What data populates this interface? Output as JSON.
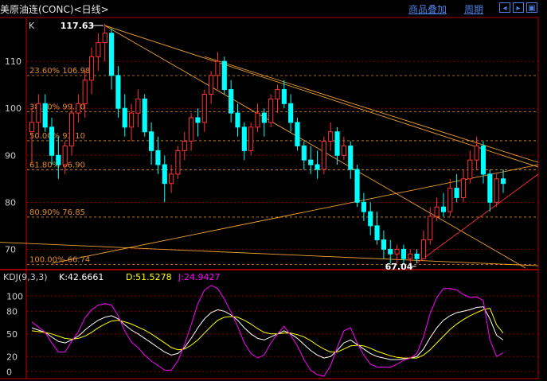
{
  "header": {
    "title": "美原油连(CONC)<日线>",
    "overlay_label": "商品叠加",
    "period_label": "周期",
    "icons": [
      "left-arrow-icon",
      "right-arrow-icon",
      "fullscreen-icon"
    ]
  },
  "price_panel": {
    "label": "K",
    "high_label": "117.63",
    "low_label": "67.04"
  },
  "kdj": {
    "name": "KDJ(9,3,3)",
    "k_label": "K:42.6661",
    "d_label": "D:51.5278",
    "j_label": "J:24.9427"
  },
  "colors": {
    "up": "#ff3232",
    "down": "#00ffff",
    "fib": "#e08a28",
    "trend": "#f0a030",
    "red_trend": "#ff3030",
    "k_line": "#ffffff",
    "d_line": "#ffff00",
    "j_line": "#ff00ff",
    "grid": "#8b0000",
    "axis": "#cc0000"
  },
  "chart_data": [
    {
      "type": "candlestick",
      "title": "美原油连(CONC)<日线>",
      "ylim": [
        66,
        119
      ],
      "y_ticks": [
        70,
        80,
        90,
        100,
        110
      ],
      "fib_levels": [
        {
          "label": "23.60% 106.98",
          "value": 106.98
        },
        {
          "label": "38.20% 99.30",
          "value": 99.3
        },
        {
          "label": "50.00% 93.10",
          "value": 93.1
        },
        {
          "label": "61.80% 86.90",
          "value": 86.9
        },
        {
          "label": "80.90% 76.85",
          "value": 76.85
        },
        {
          "label": "100.00% 66.74",
          "value": 66.74
        }
      ],
      "annotations": [
        {
          "text": "117.63",
          "value": 117.63
        },
        {
          "text": "67.04",
          "value": 67.04
        }
      ],
      "candles": [
        [
          95,
          100,
          88,
          97
        ],
        [
          97,
          103,
          94,
          101
        ],
        [
          101,
          103,
          95,
          96
        ],
        [
          96,
          98,
          88,
          90
        ],
        [
          90,
          94,
          85,
          88
        ],
        [
          88,
          93,
          86,
          92
        ],
        [
          92,
          101,
          90,
          99
        ],
        [
          99,
          103,
          97,
          101
        ],
        [
          101,
          108,
          98,
          106
        ],
        [
          106,
          113,
          103,
          111
        ],
        [
          111,
          116,
          108,
          114
        ],
        [
          114,
          118,
          110,
          116
        ],
        [
          116,
          117,
          104,
          107
        ],
        [
          107,
          109,
          98,
          100
        ],
        [
          100,
          103,
          94,
          96
        ],
        [
          96,
          101,
          93,
          99
        ],
        [
          99,
          104,
          96,
          102
        ],
        [
          102,
          103,
          94,
          95
        ],
        [
          95,
          97,
          88,
          91
        ],
        [
          91,
          94,
          86,
          88
        ],
        [
          88,
          90,
          80,
          84
        ],
        [
          84,
          88,
          82,
          86
        ],
        [
          86,
          92,
          85,
          91
        ],
        [
          91,
          95,
          89,
          93
        ],
        [
          93,
          99,
          91,
          98
        ],
        [
          98,
          100,
          94,
          97
        ],
        [
          97,
          104,
          95,
          103
        ],
        [
          103,
          108,
          101,
          107
        ],
        [
          107,
          112,
          104,
          110
        ],
        [
          110,
          111,
          103,
          104
        ],
        [
          104,
          106,
          97,
          99
        ],
        [
          99,
          101,
          94,
          96
        ],
        [
          96,
          97,
          89,
          91
        ],
        [
          91,
          97,
          90,
          96
        ],
        [
          96,
          101,
          95,
          99
        ],
        [
          99,
          100,
          94,
          97
        ],
        [
          97,
          103,
          96,
          102
        ],
        [
          102,
          105,
          99,
          104
        ],
        [
          104,
          106,
          100,
          101
        ],
        [
          101,
          103,
          95,
          97
        ],
        [
          97,
          98,
          91,
          92
        ],
        [
          92,
          93,
          87,
          89
        ],
        [
          89,
          92,
          86,
          88
        ],
        [
          88,
          91,
          85,
          87
        ],
        [
          87,
          94,
          86,
          93
        ],
        [
          93,
          97,
          91,
          95
        ],
        [
          95,
          96,
          88,
          90
        ],
        [
          90,
          94,
          89,
          92
        ],
        [
          92,
          93,
          85,
          87
        ],
        [
          87,
          88,
          79,
          80
        ],
        [
          80,
          82,
          76,
          78
        ],
        [
          78,
          80,
          73,
          75
        ],
        [
          75,
          78,
          71,
          72
        ],
        [
          72,
          74,
          68,
          70
        ],
        [
          70,
          72,
          67,
          69
        ],
        [
          69,
          71,
          67,
          70
        ],
        [
          70,
          71,
          67,
          68
        ],
        [
          68,
          70,
          67,
          69
        ],
        [
          69,
          70,
          67,
          68
        ],
        [
          68,
          74,
          68,
          72
        ],
        [
          72,
          79,
          71,
          77
        ],
        [
          77,
          81,
          76,
          79
        ],
        [
          79,
          82,
          77,
          78
        ],
        [
          78,
          85,
          77,
          83
        ],
        [
          83,
          86,
          80,
          81
        ],
        [
          81,
          87,
          80,
          85
        ],
        [
          85,
          91,
          84,
          89
        ],
        [
          89,
          94,
          87,
          92
        ],
        [
          92,
          93,
          84,
          86
        ],
        [
          86,
          87,
          78,
          80
        ],
        [
          80,
          86,
          79,
          85
        ],
        [
          85,
          87,
          82,
          84
        ]
      ]
    },
    {
      "type": "line",
      "title": "KDJ(9,3,3)",
      "ylim": [
        -5,
        115
      ],
      "y_ticks": [
        0,
        20,
        50,
        80,
        100
      ],
      "series": [
        {
          "name": "K",
          "values": [
            58,
            55,
            52,
            46,
            40,
            38,
            42,
            47,
            55,
            62,
            68,
            72,
            74,
            70,
            62,
            55,
            50,
            44,
            38,
            32,
            26,
            22,
            24,
            32,
            44,
            58,
            70,
            78,
            82,
            80,
            75,
            68,
            58,
            50,
            44,
            42,
            46,
            50,
            54,
            50,
            44,
            36,
            28,
            22,
            18,
            20,
            28,
            38,
            42,
            36,
            30,
            24,
            20,
            18,
            16,
            16,
            17,
            18,
            20,
            30,
            45,
            58,
            68,
            74,
            78,
            80,
            82,
            85,
            86,
            70,
            48,
            42
          ]
        },
        {
          "name": "D",
          "values": [
            54,
            53,
            52,
            50,
            47,
            44,
            43,
            44,
            47,
            52,
            58,
            63,
            67,
            68,
            66,
            63,
            59,
            55,
            50,
            44,
            38,
            32,
            29,
            30,
            35,
            42,
            51,
            60,
            68,
            72,
            73,
            72,
            68,
            63,
            57,
            52,
            50,
            50,
            51,
            51,
            49,
            46,
            41,
            35,
            30,
            26,
            26,
            30,
            34,
            35,
            34,
            31,
            27,
            24,
            21,
            19,
            18,
            18,
            18,
            22,
            29,
            38,
            47,
            56,
            63,
            69,
            74,
            78,
            82,
            84,
            62,
            51
          ]
        },
        {
          "name": "J",
          "values": [
            66,
            59,
            52,
            38,
            26,
            26,
            40,
            53,
            71,
            82,
            88,
            90,
            88,
            74,
            54,
            39,
            32,
            22,
            14,
            8,
            2,
            2,
            14,
            36,
            62,
            90,
            108,
            114,
            110,
            96,
            79,
            60,
            38,
            24,
            18,
            22,
            38,
            50,
            60,
            48,
            34,
            16,
            2,
            -4,
            -6,
            8,
            32,
            54,
            58,
            38,
            22,
            10,
            6,
            6,
            6,
            10,
            15,
            18,
            24,
            46,
            77,
            98,
            110,
            110,
            108,
            102,
            98,
            99,
            94,
            42,
            20,
            25
          ]
        }
      ]
    }
  ]
}
